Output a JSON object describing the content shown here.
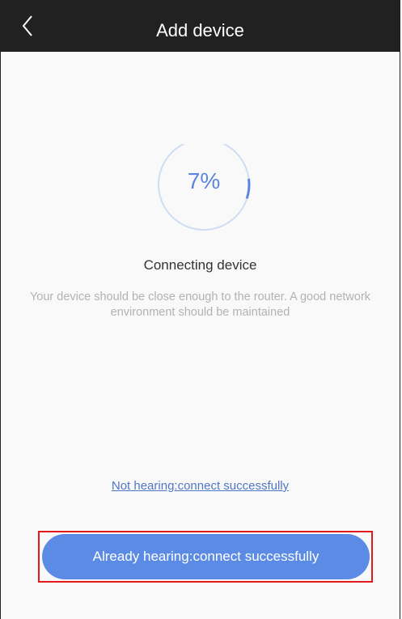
{
  "header": {
    "title": "Add device",
    "back_icon": "chevron-left-icon"
  },
  "progress": {
    "percent_label": "7%",
    "value": 0.07,
    "color": "#5a86df",
    "track_color": "#cfdcf5"
  },
  "status": {
    "title": "Connecting device",
    "hint": "Your device should be close enough to the router. A good network environment should be maintained"
  },
  "actions": {
    "not_hearing_link": "Not hearing:connect successfully",
    "already_hearing_button": "Already hearing:connect successfully",
    "button_color": "#5b8be5",
    "highlight_color": "#e31a1a"
  }
}
